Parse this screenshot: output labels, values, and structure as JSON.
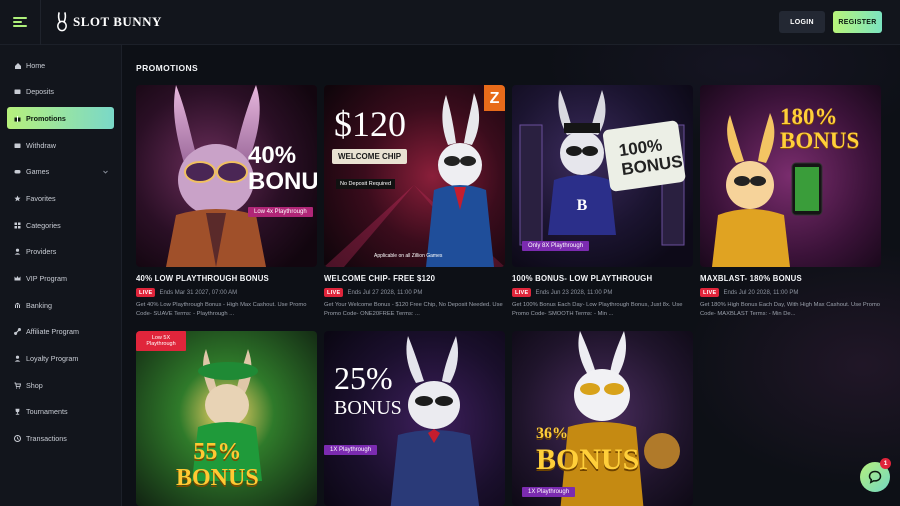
{
  "brand": {
    "name": "SLOT BUNNY"
  },
  "header": {
    "login_label": "LOGIN",
    "register_label": "REGISTER"
  },
  "sidebar": {
    "items": [
      {
        "label": "Home",
        "icon": "home-icon"
      },
      {
        "label": "Deposits",
        "icon": "deposit-icon"
      },
      {
        "label": "Promotions",
        "icon": "gift-icon",
        "active": true
      },
      {
        "label": "Withdraw",
        "icon": "withdraw-icon"
      },
      {
        "label": "Games",
        "icon": "gamepad-icon",
        "has_chevron": true
      },
      {
        "label": "Favorites",
        "icon": "star-icon"
      },
      {
        "label": "Categories",
        "icon": "categories-icon"
      },
      {
        "label": "Providers",
        "icon": "providers-icon"
      },
      {
        "label": "VIP Program",
        "icon": "crown-icon"
      },
      {
        "label": "Banking",
        "icon": "bank-icon"
      },
      {
        "label": "Affiliate Program",
        "icon": "link-icon"
      },
      {
        "label": "Loyalty Program",
        "icon": "loyalty-icon"
      },
      {
        "label": "Shop",
        "icon": "cart-icon"
      },
      {
        "label": "Tournaments",
        "icon": "trophy-icon"
      },
      {
        "label": "Transactions",
        "icon": "transactions-icon"
      }
    ]
  },
  "main": {
    "title": "PROMOTIONS",
    "live_label": "LIVE",
    "promotions": [
      {
        "title": "40% LOW PLAYTHROUGH BONUS",
        "ends": "Ends Mar 31 2027, 07:00 AM",
        "description": "Get 40% Low Playthrough Bonus - High Max Cashout. Use Promo Code- SUAVE Terms: - Playthrough ...",
        "image_text": [
          "40%",
          "BONUS"
        ],
        "image_tag": "Low 4x Playthrough"
      },
      {
        "title": "WELCOME CHIP- FREE $120",
        "ends": "Ends Jul 27 2028, 11:00 PM",
        "description": "Get Your Welcome Bonus - $120 Free Chip, No Deposit Needed. Use Promo Code- ONE20FREE Terms: ...",
        "image_text": [
          "$120",
          "WELCOME CHIP",
          "No Deposit Required",
          "Applicable on all Zillion Games"
        ],
        "image_tag": ""
      },
      {
        "title": "100% BONUS- LOW PLAYTHROUGH",
        "ends": "Ends Jun 23 2028, 11:00 PM",
        "description": "Get 100% Bonus Each Day- Low Playthrough Bonus, Just 8x. Use Promo Code- SMOOTH Terms: - Min ...",
        "image_text": [
          "100%",
          "BONUS"
        ],
        "image_tag": "Only 8X Playthrough"
      },
      {
        "title": "MAXBLAST- 180% BONUS",
        "ends": "Ends Jul 20 2028, 11:00 PM",
        "description": "Get 180% High Bonus Each Day, With High Max Cashout. Use Promo Code- MAXBLAST Terms: - Min De...",
        "image_text": [
          "180%",
          "BONUS"
        ],
        "image_tag": ""
      },
      {
        "title": "",
        "image_text": [
          "55%",
          "BONUS"
        ],
        "image_tag": "Low 5X Playthrough"
      },
      {
        "title": "",
        "image_text": [
          "25%",
          "BONUS"
        ],
        "image_tag": "1X Playthrough"
      },
      {
        "title": "",
        "image_text": [
          "36%",
          "BONUS"
        ],
        "image_tag": "1X Playthrough"
      }
    ]
  },
  "chat": {
    "badge_count": "1"
  },
  "colors": {
    "accent_start": "#b6f07c",
    "accent_end": "#7ad8c8",
    "live": "#e0253b",
    "background": "#0d1016"
  }
}
